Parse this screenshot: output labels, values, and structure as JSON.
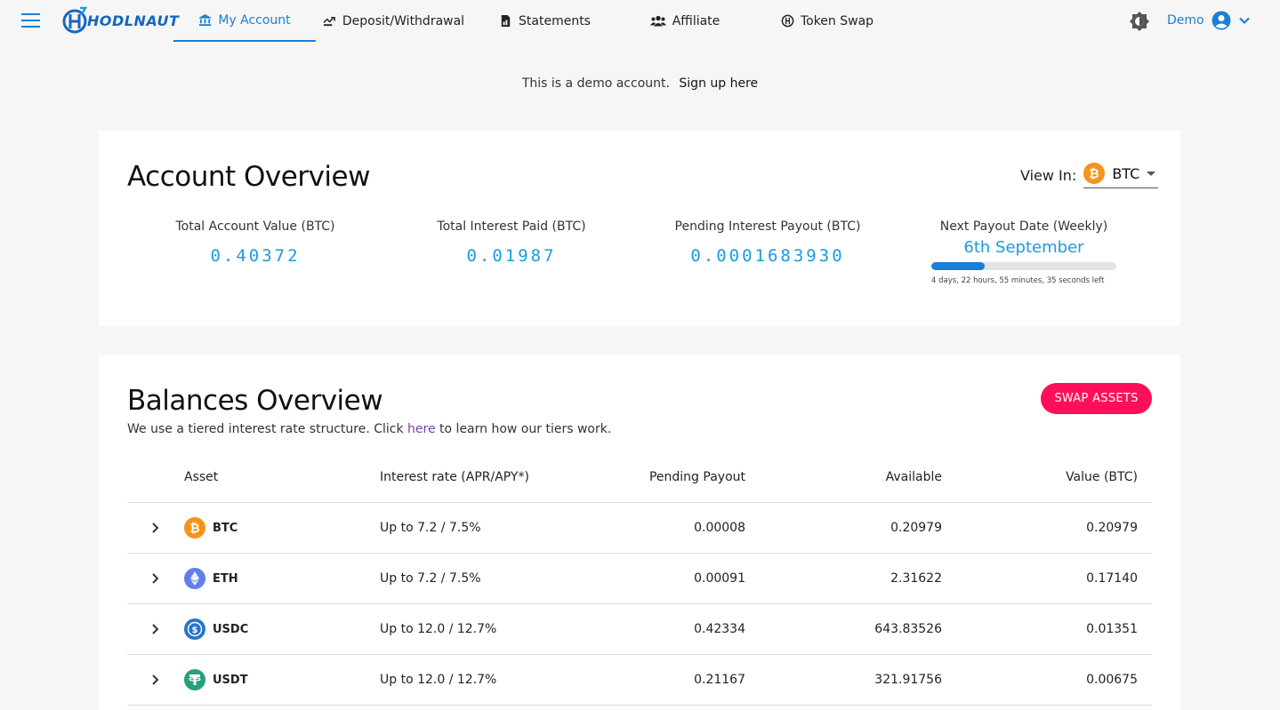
{
  "brand": {
    "name": "HODLNAUT",
    "color": "#1566c0"
  },
  "nav": {
    "tabs": [
      {
        "label": "My Account",
        "icon": "bank-icon"
      },
      {
        "label": "Deposit/Withdrawal",
        "icon": "transfer-icon"
      },
      {
        "label": "Statements",
        "icon": "document-icon"
      },
      {
        "label": "Affiliate",
        "icon": "people-icon"
      },
      {
        "label": "Token Swap",
        "icon": "swap-circle-icon"
      }
    ],
    "active": "My Account"
  },
  "user": {
    "name": "Demo"
  },
  "banner": {
    "text": "This is a demo account.",
    "link": "Sign up here"
  },
  "overview": {
    "title": "Account Overview",
    "view_in_label": "View In:",
    "view_in_value": "BTC",
    "stats": [
      {
        "label": "Total Account Value (BTC)",
        "value": "0.40372"
      },
      {
        "label": "Total Interest Paid (BTC)",
        "value": "0.01987"
      },
      {
        "label": "Pending Interest Payout (BTC)",
        "value": "0.0001683930"
      }
    ],
    "payout": {
      "label": "Next Payout Date (Weekly)",
      "date": "6th September",
      "progress_percent": 29,
      "remaining": "4 days, 22 hours, 55 minutes, 35 seconds left"
    }
  },
  "balances": {
    "title": "Balances Overview",
    "swap_button": "SWAP ASSETS",
    "note_prefix": "We use a tiered interest rate structure. Click",
    "note_link": "here",
    "note_suffix": "to learn how our tiers work.",
    "columns": {
      "asset": "Asset",
      "rate": "Interest rate (APR/APY*)",
      "pending": "Pending Payout",
      "available": "Available",
      "value": "Value (BTC)"
    },
    "rows": [
      {
        "asset": "BTC",
        "icon": "bitcoin-icon",
        "color": "#f7931a",
        "rate": "Up to 7.2 / 7.5%",
        "pending": "0.00008",
        "available": "0.20979",
        "value": "0.20979"
      },
      {
        "asset": "ETH",
        "icon": "ethereum-icon",
        "color": "#627eea",
        "rate": "Up to 7.2 / 7.5%",
        "pending": "0.00091",
        "available": "2.31622",
        "value": "0.17140"
      },
      {
        "asset": "USDC",
        "icon": "usdc-icon",
        "color": "#2775ca",
        "rate": "Up to 12.0 / 12.7%",
        "pending": "0.42334",
        "available": "643.83526",
        "value": "0.01351"
      },
      {
        "asset": "USDT",
        "icon": "tether-icon",
        "color": "#26a17b",
        "rate": "Up to 12.0 / 12.7%",
        "pending": "0.21167",
        "available": "321.91756",
        "value": "0.00675"
      }
    ]
  },
  "colors": {
    "accent": "#1b7fd6",
    "value_blue": "#1b9be0",
    "swap": "#ff0f5a"
  }
}
